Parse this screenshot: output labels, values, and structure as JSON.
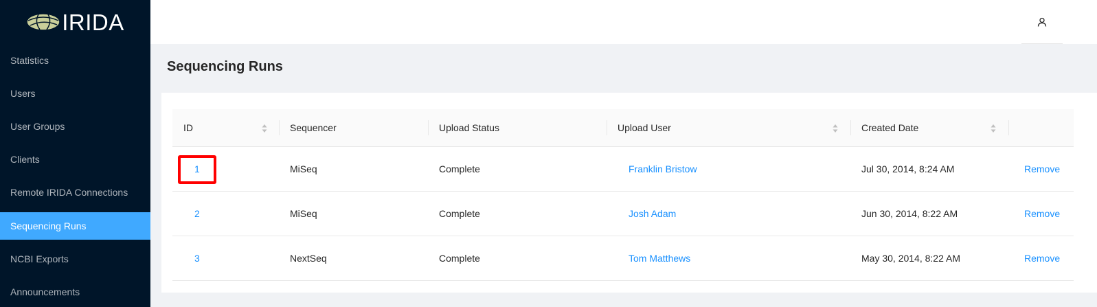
{
  "app": {
    "logo_text": "IRIDA",
    "icons": {
      "logo": "irida-globe-logo",
      "user": "user-icon",
      "sort": "sort-icon"
    }
  },
  "sidebar": {
    "items": [
      {
        "label": "Statistics",
        "active": false
      },
      {
        "label": "Users",
        "active": false
      },
      {
        "label": "User Groups",
        "active": false
      },
      {
        "label": "Clients",
        "active": false
      },
      {
        "label": "Remote IRIDA Connections",
        "active": false
      },
      {
        "label": "Sequencing Runs",
        "active": true
      },
      {
        "label": "NCBI Exports",
        "active": false
      },
      {
        "label": "Announcements",
        "active": false
      }
    ]
  },
  "page": {
    "title": "Sequencing Runs"
  },
  "table": {
    "columns": [
      "ID",
      "Sequencer",
      "Upload Status",
      "Upload User",
      "Created Date",
      ""
    ],
    "rows": [
      {
        "id": "1",
        "sequencer": "MiSeq",
        "status": "Complete",
        "user": "Franklin Bristow",
        "created": "Jul 30, 2014, 8:24 AM",
        "action": "Remove"
      },
      {
        "id": "2",
        "sequencer": "MiSeq",
        "status": "Complete",
        "user": "Josh Adam",
        "created": "Jun 30, 2014, 8:22 AM",
        "action": "Remove"
      },
      {
        "id": "3",
        "sequencer": "NextSeq",
        "status": "Complete",
        "user": "Tom Matthews",
        "created": "May 30, 2014, 8:22 AM",
        "action": "Remove"
      }
    ]
  },
  "colors": {
    "sidebar_bg": "#001529",
    "active_item": "#40a9ff",
    "link": "#1890ff",
    "highlight": "#ff0000"
  }
}
